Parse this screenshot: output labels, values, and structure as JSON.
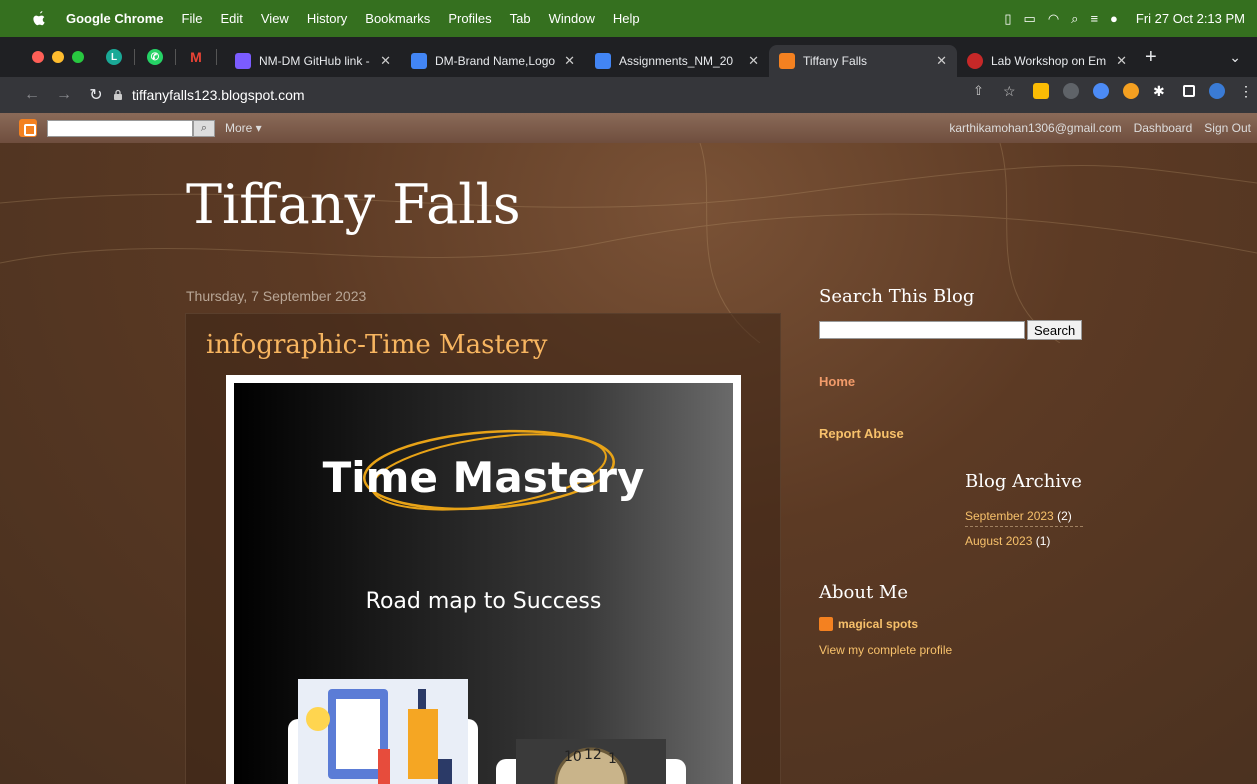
{
  "menubar": {
    "app": "Google Chrome",
    "items": [
      "File",
      "Edit",
      "View",
      "History",
      "Bookmarks",
      "Profiles",
      "Tab",
      "Window",
      "Help"
    ],
    "clock": "Fri 27 Oct  2:13 PM"
  },
  "tabs": [
    {
      "title": "NM-DM GitHub link -",
      "color": "#7b5cff"
    },
    {
      "title": "DM-Brand Name,Logo",
      "color": "#4285f4"
    },
    {
      "title": "Assignments_NM_20",
      "color": "#4285f4"
    },
    {
      "title": "Tiffany Falls",
      "color": "#f48120",
      "active": true
    },
    {
      "title": "Lab Workshop on Em",
      "color": "#c62828"
    }
  ],
  "url": "tiffanyfalls123.blogspot.com",
  "blogger_nav": {
    "more": "More ▾",
    "email": "karthikamohan1306@gmail.com",
    "dashboard": "Dashboard",
    "signout": "Sign Out"
  },
  "blog": {
    "title": "Tiffany Falls",
    "date": "Thursday, 7 September 2023",
    "post_title": "infographic-Time Mastery",
    "infographic_title": "Time Mastery",
    "infographic_sub": "Road map to Success"
  },
  "sidebar": {
    "search_heading": "Search This Blog",
    "search_button": "Search",
    "home": "Home",
    "report": "Report Abuse",
    "archive_heading": "Blog Archive",
    "archive": [
      {
        "label": "September 2023",
        "count": "(2)"
      },
      {
        "label": "August 2023",
        "count": "(1)"
      }
    ],
    "about_heading": "About Me",
    "profile_name": "magical spots",
    "view_profile": "View my complete profile"
  }
}
